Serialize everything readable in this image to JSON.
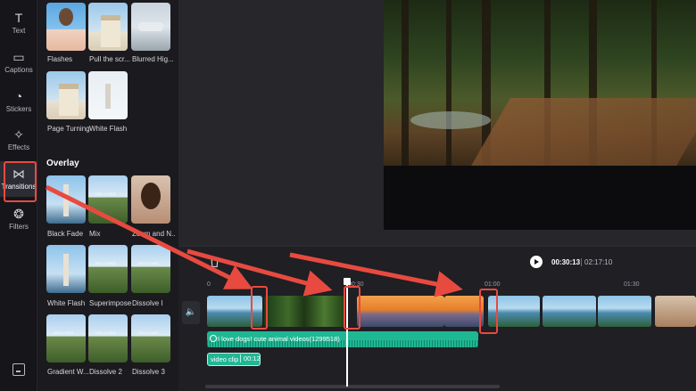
{
  "rail": {
    "items": [
      {
        "label": "Text",
        "glyph": "T"
      },
      {
        "label": "Captions",
        "glyph": "▭"
      },
      {
        "label": "Stickers",
        "glyph": "◔"
      },
      {
        "label": "Effects",
        "glyph": "✧"
      },
      {
        "label": "Transitions",
        "glyph": "⋈"
      },
      {
        "label": "Filters",
        "glyph": "❂"
      }
    ],
    "active": "Transitions"
  },
  "panel": {
    "top_tiles": [
      "Flashes",
      "Pull the scr...",
      "Blurred Hig...",
      "Page Turning",
      "White Flash"
    ],
    "overlay_title": "Overlay",
    "overlay_tiles": [
      "Black Fade",
      "Mix",
      "Zoom and N...",
      "White Flash",
      "Superimpose",
      "Dissolve I",
      "Gradient W...",
      "Dissolve 2",
      "Dissolve 3"
    ]
  },
  "player": {
    "current_time": "00:30:13",
    "total_time": "02:17:10"
  },
  "timeline": {
    "ticks": [
      "0",
      "00:30",
      "01:00",
      "01:30"
    ],
    "audio_clip_label": "I love dogs! cute animal videos(1299518)",
    "text_clip_label": "video clip",
    "text_clip_duration": "00:12"
  },
  "colors": {
    "accent_teal": "#1fb894",
    "highlight_red": "#e84a3f"
  },
  "icons": {
    "trash": "trash-icon",
    "volume": "volume-icon",
    "play": "play-icon"
  }
}
